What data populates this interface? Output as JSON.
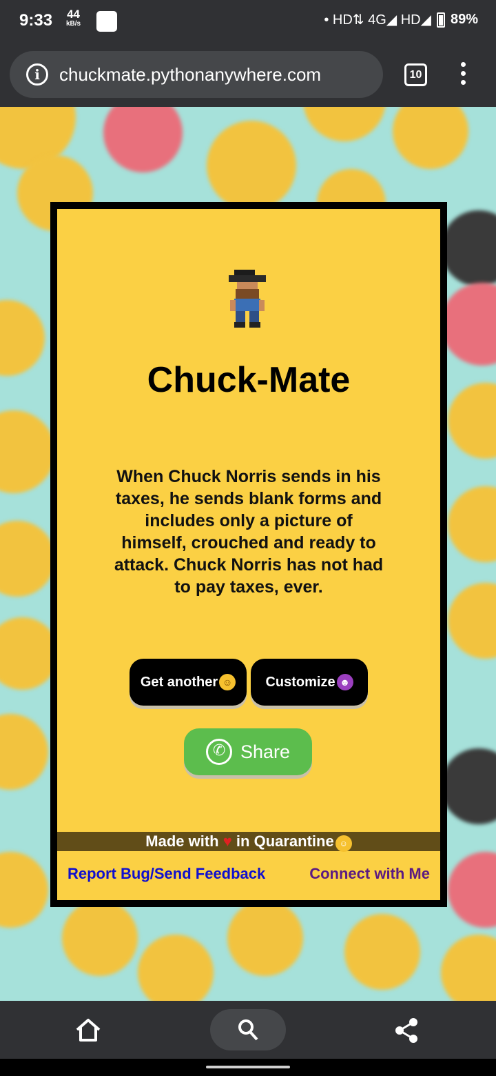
{
  "status_bar": {
    "time": "9:33",
    "net_speed": "44",
    "net_speed_unit": "kB/s",
    "signal_text": "• HD⇅ 4G◢ HD◢",
    "battery": "89%"
  },
  "browser": {
    "url": "chuckmate.pythonanywhere.com",
    "tab_count": "10"
  },
  "card": {
    "title": "Chuck-Mate",
    "joke": "When Chuck Norris sends in his taxes, he sends blank forms and includes only a picture of himself, crouched and ready to attack. Chuck Norris has not had to pay taxes, ever.",
    "get_another_label": "Get another",
    "customize_label": "Customize",
    "share_label": "Share",
    "footer_made_with": "Made with",
    "footer_in_quarantine": "in Quarantine",
    "report_link": "Report Bug/Send Feedback",
    "connect_link": "Connect with Me"
  },
  "icons": {
    "info": "info-icon",
    "tabs": "tabs-icon",
    "menu": "kebab-menu-icon",
    "laugh": "laughing-emoji-icon",
    "devil": "devil-emoji-icon",
    "whatsapp": "whatsapp-icon",
    "heart": "heart-icon",
    "mask": "mask-emoji-icon",
    "home": "home-icon",
    "search": "search-icon",
    "share": "share-icon"
  },
  "colors": {
    "card_yellow": "#fbd044",
    "background_teal": "#a6e1da",
    "share_green": "#5cbd4d",
    "link_blue": "#0f0fcf",
    "link_purple": "#5b1a82",
    "footer_brown": "#614d18"
  }
}
